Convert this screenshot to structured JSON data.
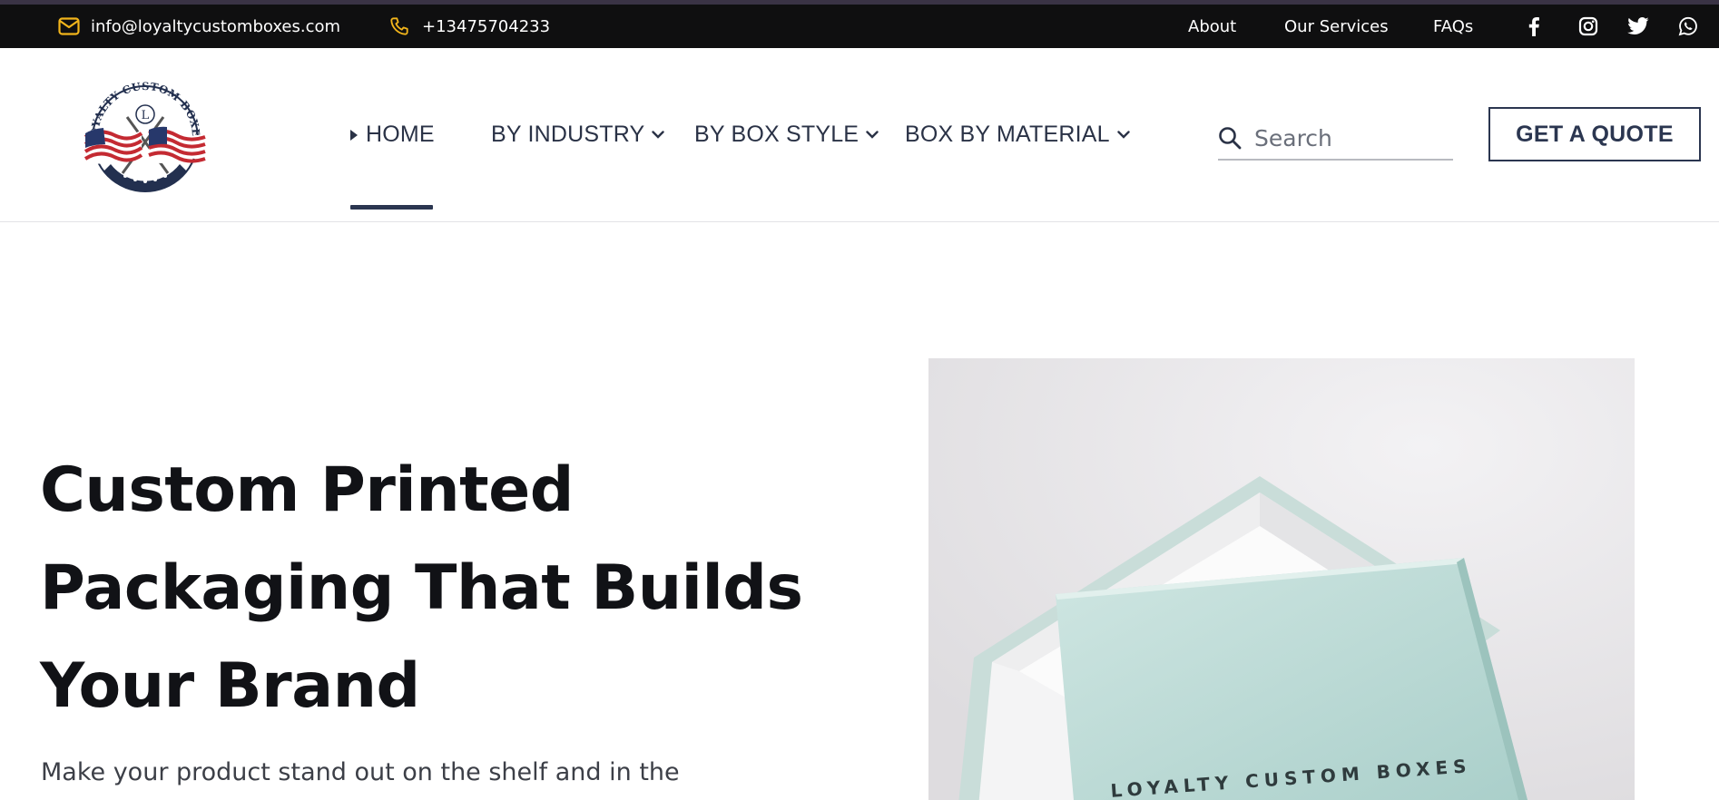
{
  "topbar": {
    "email": "info@loyaltycustomboxes.com",
    "phone": "+13475704233",
    "links": [
      "About",
      "Our Services",
      "FAQs"
    ],
    "social_icons": [
      "facebook-icon",
      "instagram-icon",
      "twitter-icon",
      "whatsapp-icon"
    ],
    "icon_accent_color": "#f2b51b"
  },
  "logo": {
    "text": "LOYALTY CUSTOM BOXES",
    "monogram": "L"
  },
  "nav": {
    "items": [
      {
        "label": "HOME",
        "active": true
      },
      {
        "label": "BY INDUSTRY",
        "dropdown": true
      },
      {
        "label": "BY BOX STYLE",
        "dropdown": true
      },
      {
        "label": "BOX BY MATERIAL",
        "dropdown": true
      }
    ],
    "search_placeholder": "Search",
    "quote_label": "GET A QUOTE",
    "accent_color": "#2b3650"
  },
  "hero": {
    "title_lines": [
      "Custom Printed",
      "Packaging That Builds",
      "Your Brand"
    ],
    "subtitle": "Make your product stand out on the shelf and in the",
    "image_box_text": "LOYALTY CUSTOM BOXES"
  }
}
